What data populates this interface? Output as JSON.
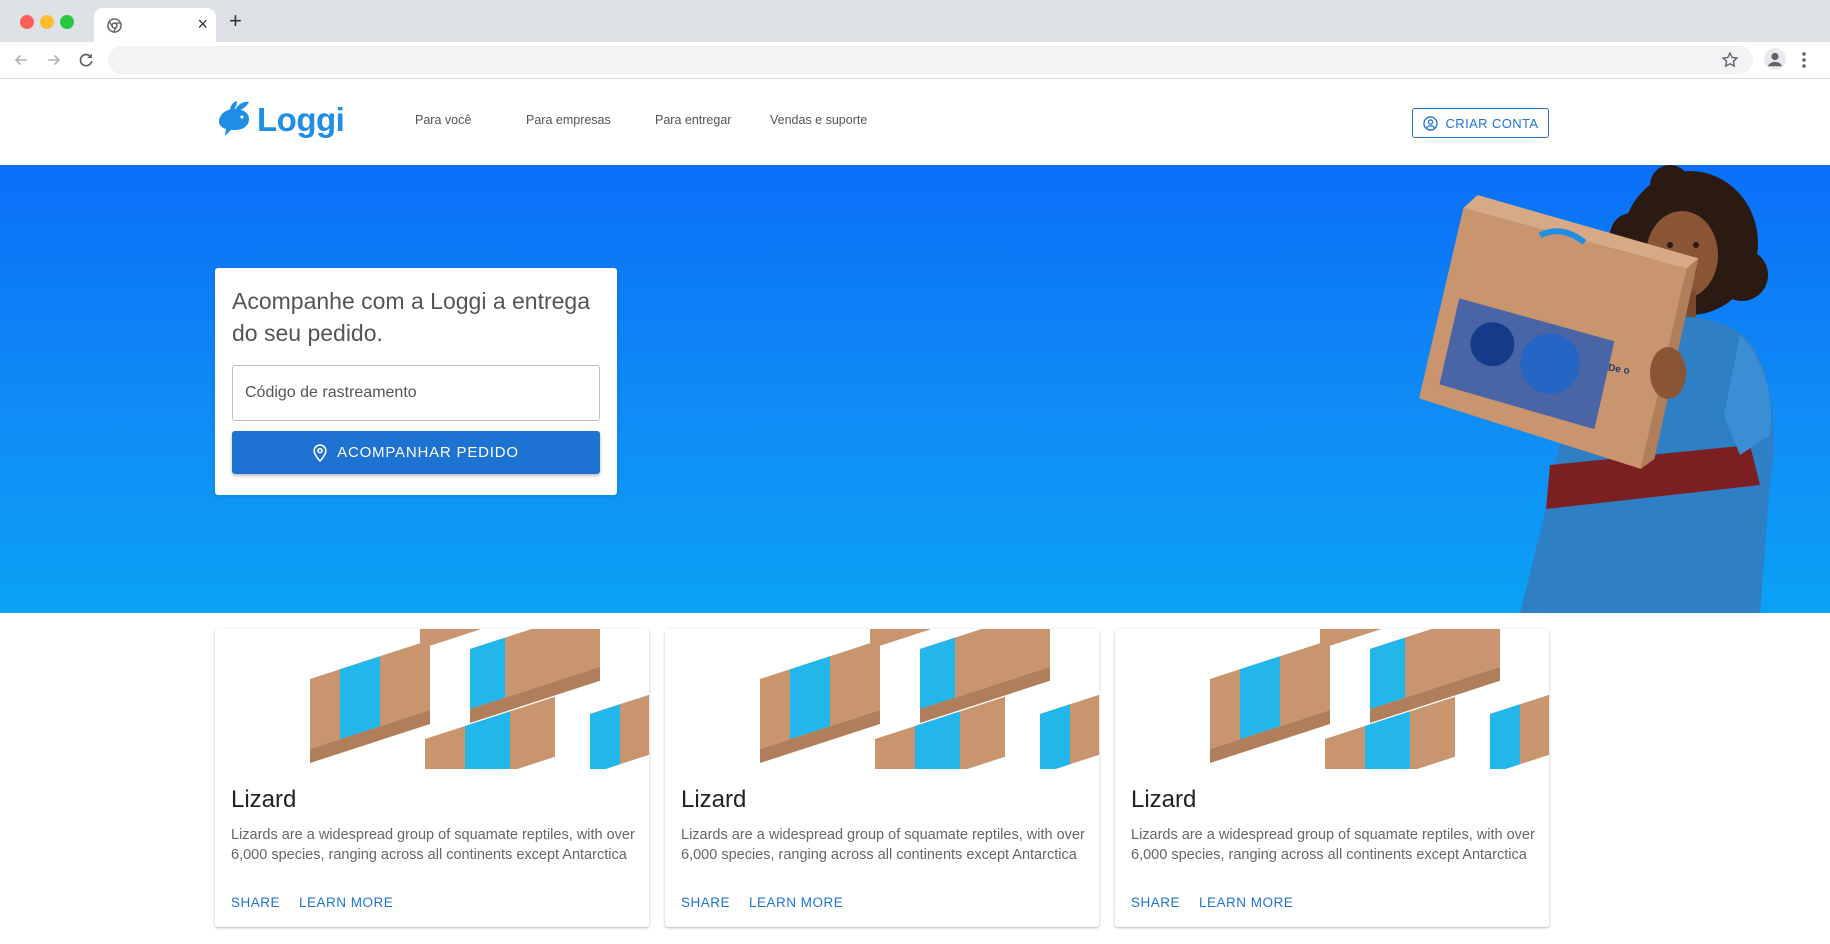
{
  "browser": {
    "tab_close": "×",
    "new_tab": "+"
  },
  "header": {
    "logo_text": "Loggi",
    "nav": [
      "Para você",
      "Para empresas",
      "Para entregar",
      "Vendas e suporte"
    ],
    "create_account": "CRIAR CONTA"
  },
  "hero": {
    "title": "Acompanhe com a Loggi a entrega do seu pedido.",
    "tracking_placeholder": "Código de rastreamento",
    "track_button": "ACOMPANHAR PEDIDO"
  },
  "cards": [
    {
      "title": "Lizard",
      "text": "Lizards are a widespread group of squamate reptiles, with over 6,000 species, ranging across all continents except Antarctica",
      "actions": [
        "SHARE",
        "LEARN MORE"
      ]
    },
    {
      "title": "Lizard",
      "text": "Lizards are a widespread group of squamate reptiles, with over 6,000 species, ranging across all continents except Antarctica",
      "actions": [
        "SHARE",
        "LEARN MORE"
      ]
    },
    {
      "title": "Lizard",
      "text": "Lizards are a widespread group of squamate reptiles, with over 6,000 species, ranging across all continents except Antarctica",
      "actions": [
        "SHARE",
        "LEARN MORE"
      ]
    }
  ],
  "colors": {
    "brand_blue": "#1e73d2",
    "logo_blue": "#1e8ee6",
    "hero_top": "#0a6ff8",
    "hero_bottom": "#0aa2f5",
    "box_cardboard": "#c9956e",
    "box_stripe": "#22b6ea"
  },
  "icons": [
    "back-arrow-icon",
    "forward-arrow-icon",
    "reload-icon",
    "star-icon",
    "profile-icon",
    "more-vert-icon",
    "account-circle-icon",
    "location-pin-icon"
  ]
}
